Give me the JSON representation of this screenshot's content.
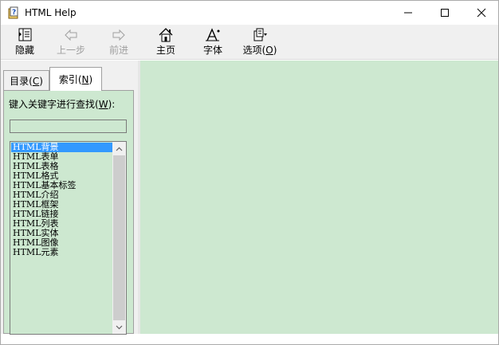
{
  "window": {
    "title": "HTML Help",
    "controls": {
      "minimize": "minimize-icon",
      "maximize": "maximize-icon",
      "close": "close-icon"
    }
  },
  "toolbar": {
    "hide": {
      "label": "隐藏",
      "icon": "hide-pane-icon"
    },
    "back": {
      "label": "上一步",
      "icon": "back-arrow-icon",
      "enabled": false
    },
    "forward": {
      "label": "前进",
      "icon": "forward-arrow-icon",
      "enabled": false
    },
    "home": {
      "label": "主页",
      "icon": "home-icon"
    },
    "font": {
      "label": "字体",
      "icon": "font-icon"
    },
    "options": {
      "label": "选项",
      "mnemonic": "O",
      "icon": "options-icon"
    }
  },
  "tabs": {
    "contents": {
      "label": "目录",
      "mnemonic": "C"
    },
    "index": {
      "label": "索引",
      "mnemonic": "N",
      "active": true
    }
  },
  "index_page": {
    "keyword_label": "键入关键字进行查找",
    "keyword_mnemonic": "W",
    "keyword_value": "",
    "items": [
      "HTML背景",
      "HTML表单",
      "HTML表格",
      "HTML格式",
      "HTML基本标签",
      "HTML介绍",
      "HTML框架",
      "HTML链接",
      "HTML列表",
      "HTML实体",
      "HTML图像",
      "HTML元素"
    ],
    "selected_index": 0
  },
  "colors": {
    "pane_background": "#cde8d0",
    "selection": "#3399ff",
    "toolbar_background": "#f0f0f0"
  }
}
